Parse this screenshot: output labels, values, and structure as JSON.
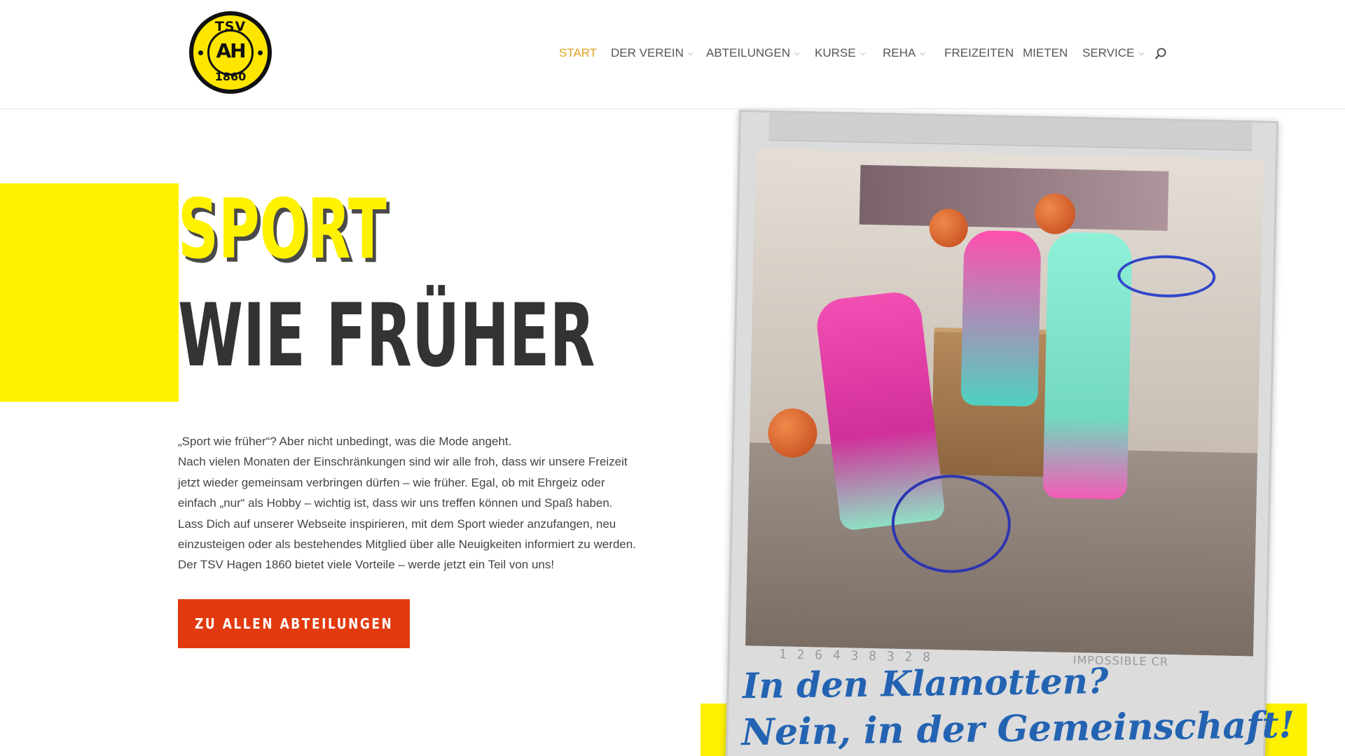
{
  "logo": {
    "top_text": "TSV",
    "center_text": "AH",
    "bottom_text": "1860"
  },
  "nav": {
    "items": [
      {
        "label": "START",
        "active": true,
        "dropdown": false
      },
      {
        "label": "DER VEREIN",
        "active": false,
        "dropdown": true
      },
      {
        "label": "ABTEILUNGEN",
        "active": false,
        "dropdown": true
      },
      {
        "label": "KURSE",
        "active": false,
        "dropdown": true
      },
      {
        "label": "REHA",
        "active": false,
        "dropdown": true
      },
      {
        "label": "FREIZEITEN",
        "active": false,
        "dropdown": false
      },
      {
        "label": "MIETEN",
        "active": false,
        "dropdown": false
      },
      {
        "label": "SERVICE",
        "active": false,
        "dropdown": true
      }
    ],
    "search_icon": "search-icon"
  },
  "hero": {
    "heading_line1": "SPORT",
    "heading_line2": "WIE FRÜHER",
    "paragraphs": [
      "„Sport wie früher“? Aber nicht unbedingt, was die Mode angeht.",
      "Nach vielen Monaten der Einschränkungen sind wir alle froh, dass wir unsere Freizeit",
      "jetzt wieder gemeinsam verbringen dürfen – wie früher. Egal, ob mit Ehrgeiz oder",
      "einfach „nur“ als Hobby – wichtig ist, dass wir uns treffen können und Spaß haben.",
      "Lass Dich auf unserer Webseite inspirieren, mit dem Sport wieder anzufangen, neu",
      "einzusteigen oder als bestehendes Mitglied über alle Neuigkeiten informiert zu werden.",
      "Der TSV Hagen 1860 bietet viele Vorteile – werde jetzt ein Teil von uns!"
    ],
    "cta_label": "ZU ALLEN ABTEILUNGEN"
  },
  "polaroid": {
    "film_code": "1 2 6 4 3 8 3 2 8",
    "film_brand": "IMPOSSIBLE CR",
    "caption_line1": "In den Klamotten?",
    "caption_line2": "Nein, in der Gemeinschaft!"
  },
  "colors": {
    "accent_yellow": "#fff200",
    "cta_red": "#e23a0e",
    "nav_active": "#e3a11c",
    "caption_blue": "#2363b2",
    "heading_dark": "#333333"
  }
}
